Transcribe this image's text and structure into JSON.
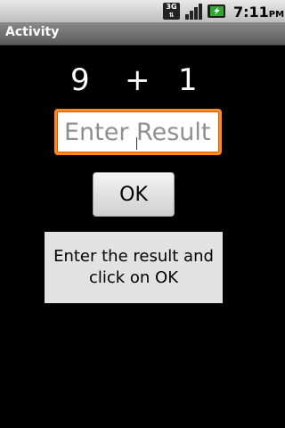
{
  "status_bar": {
    "network_type": "3G",
    "time": "7:11",
    "ampm": "PM",
    "icons": [
      "3g-data-icon",
      "signal-strength-icon",
      "battery-charging-icon"
    ]
  },
  "title_bar": {
    "title": "Activity"
  },
  "equation": {
    "operand_a": "9",
    "operator": "+",
    "operand_b": "1"
  },
  "result_input": {
    "value": "",
    "placeholder": "Enter Result"
  },
  "ok_button": {
    "label": "OK"
  },
  "message": {
    "text": "Enter the result and click on OK"
  },
  "colors": {
    "input_focus_border": "#ff8a1a",
    "message_background": "#e2e2e2",
    "screen_background": "#000000"
  }
}
